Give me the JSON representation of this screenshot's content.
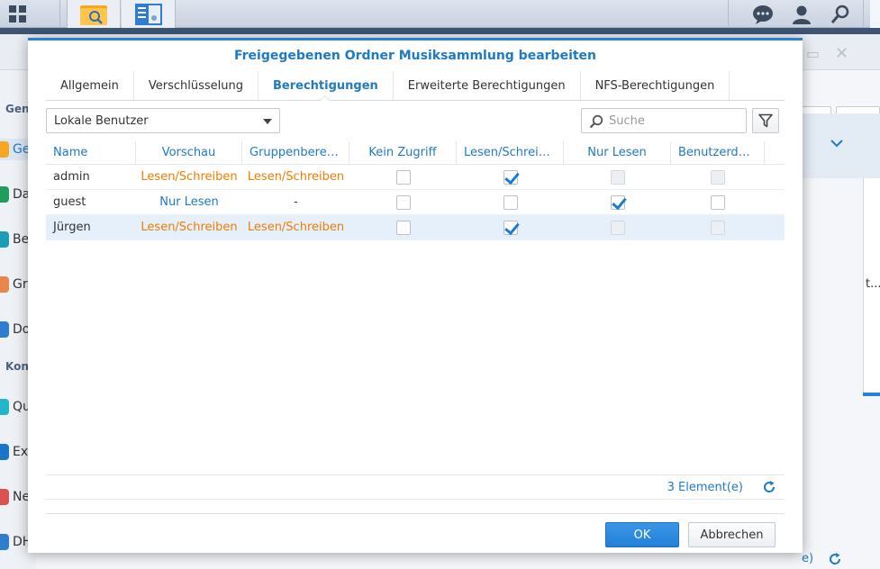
{
  "dialog": {
    "title": "Freigegebenen Ordner Musiksammlung bearbeiten",
    "tabs": [
      {
        "label": "Allgemein"
      },
      {
        "label": "Verschlüsselung"
      },
      {
        "label": "Berechtigungen"
      },
      {
        "label": "Erweiterte Berechtigungen"
      },
      {
        "label": "NFS-Berechtigungen"
      }
    ],
    "active_tab": "Berechtigungen",
    "user_type_select": {
      "value": "Lokale Benutzer"
    },
    "search": {
      "placeholder": "Suche"
    },
    "grid": {
      "columns": [
        "Name",
        "Vorschau",
        "Gruppenberec...",
        "Kein Zugriff",
        "Lesen/Schreib...",
        "Nur Lesen",
        "Benutzerdefi..."
      ],
      "rows": [
        {
          "name": "admin",
          "preview": "Lesen/Schreiben",
          "group": "Lesen/Schreiben",
          "no_access": false,
          "read_write": true,
          "read_only": false,
          "custom": false,
          "read_only_disabled": true,
          "custom_disabled": true
        },
        {
          "name": "guest",
          "preview": "Nur Lesen",
          "group": "-",
          "no_access": false,
          "read_write": false,
          "read_only": true,
          "custom": false,
          "read_only_disabled": false,
          "custom_disabled": false
        },
        {
          "name": "Jürgen",
          "preview": "Lesen/Schreiben",
          "group": "Lesen/Schreiben",
          "no_access": false,
          "read_write": true,
          "read_only": false,
          "custom": false,
          "read_only_disabled": true,
          "custom_disabled": true,
          "selected": true
        }
      ]
    },
    "item_count": "3 Element(e)",
    "ok_label": "OK",
    "cancel_label": "Abbrechen"
  },
  "background": {
    "sidebar_sections": [
      "Gen",
      "Kon"
    ],
    "sidebar_items": [
      "Ge",
      "Da",
      "Be",
      "Gr",
      "Do",
      "Qu",
      "Ex",
      "Ne",
      "DH"
    ],
    "right_panel_text": "t...",
    "right_bottom_text": "e)"
  },
  "colors": {
    "accent": "#1f7ac2",
    "orange": "#f07d00",
    "selected_row": "#e5f0fa",
    "ok_button": "#2b86dc"
  }
}
